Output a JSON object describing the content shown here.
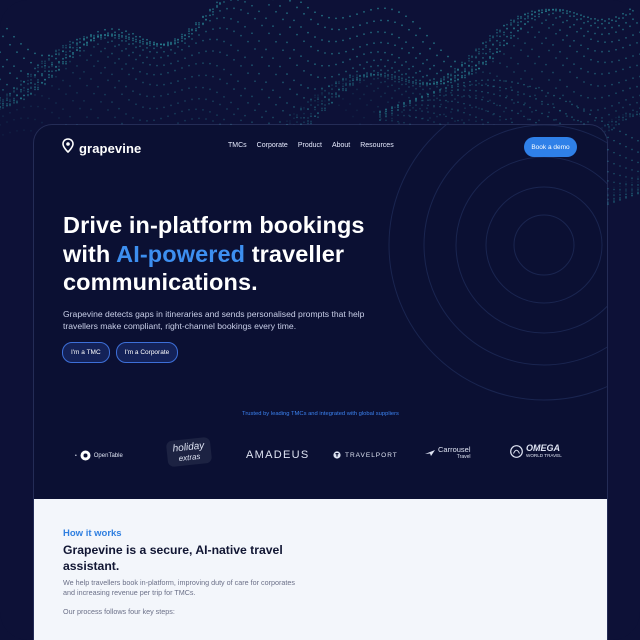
{
  "nav": {
    "logo": "grapevine",
    "menu": [
      "TMCs",
      "Corporate",
      "Product",
      "About",
      "Resources"
    ],
    "cta": "Book a demo"
  },
  "hero": {
    "headline_line1": "Drive in-platform bookings",
    "headline_line2_pre": "with ",
    "headline_accent": "AI-powered",
    "headline_line2_post": " traveller",
    "headline_line3": "communications.",
    "subtext": "Grapevine detects gaps in itineraries and sends personalised prompts that help travellers make compliant, right-channel bookings every time.",
    "buttons": [
      "I'm a TMC",
      "I'm a Corporate"
    ]
  },
  "trusted": {
    "text": "Trusted by leading TMCs and integrated with global suppliers",
    "logos": {
      "opentable": "OpenTable",
      "holiday_top": "holiday",
      "holiday_bottom": "extras",
      "amadeus": "amadeus",
      "travelport": "TRAVELPORT",
      "carrousel_top": "Carrousel",
      "carrousel_bottom": "Travel",
      "omega_top": "OMEGA",
      "omega_bottom": "WORLD TRAVEL"
    }
  },
  "how_it_works": {
    "eyebrow": "How it works",
    "title": "Grapevine is a secure, AI-native travel assistant.",
    "paragraph1": "We help travellers book in-platform, improving duty of care for corporates and increasing revenue per trip for TMCs.",
    "paragraph2": "Our process follows four key steps:"
  },
  "colors": {
    "background": "#0d1137",
    "accent": "#3d8ff0",
    "button": "#2f80e8",
    "wave": "#2b8c9a",
    "section_light": "#f3f6fb"
  },
  "icons": [
    "location-pin-icon",
    "travelport-icon",
    "carrousel-plane-icon",
    "omega-globe-icon"
  ]
}
